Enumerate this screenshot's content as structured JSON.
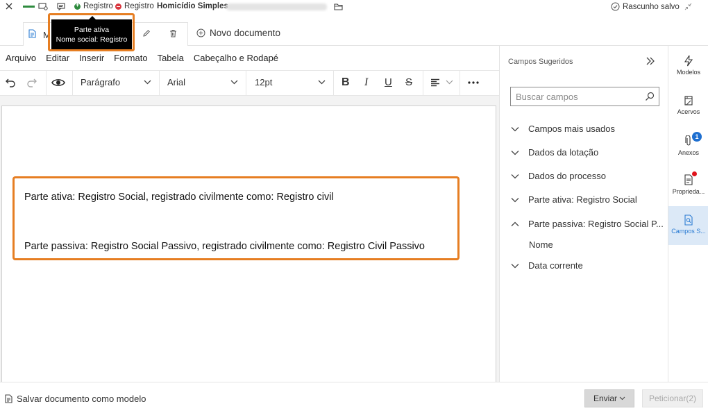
{
  "topbar": {
    "party1_label": "Registro",
    "party2_label": "Registro",
    "case_title": "Homicídio Simples",
    "draft_status": "Rascunho salvo"
  },
  "tooltip": {
    "line1": "Parte ativa",
    "line2": "Nome social: Registro"
  },
  "tabs": {
    "doc_tab_label": "M",
    "new_document_label": "Novo documento"
  },
  "menu": {
    "items": [
      "Arquivo",
      "Editar",
      "Inserir",
      "Formato",
      "Tabela",
      "Cabeçalho e Rodapé"
    ]
  },
  "toolbar": {
    "block_format": "Parágrafo",
    "font_family": "Arial",
    "font_size": "12pt"
  },
  "document": {
    "line1": "Parte ativa: Registro Social, registrado civilmente como: Registro civil",
    "line2": "Parte passiva: Registro Social Passivo, registrado civilmente como: Registro Civil Passivo"
  },
  "right_panel": {
    "title": "Campos Sugeridos",
    "search_placeholder": "Buscar campos",
    "fields": [
      {
        "label": "Campos mais usados",
        "expanded": false
      },
      {
        "label": "Dados da lotação",
        "expanded": false
      },
      {
        "label": "Dados do processo",
        "expanded": false
      },
      {
        "label": "Parte ativa: Registro Social",
        "expanded": false
      },
      {
        "label": "Parte passiva: Registro Social P...",
        "expanded": true
      },
      {
        "label": "Data corrente",
        "expanded": false
      }
    ],
    "subfield": "Nome"
  },
  "rail": {
    "items": [
      "Modelos",
      "Acervos",
      "Anexos",
      "Proprieda...",
      "Campos S..."
    ],
    "anexos_badge": "1",
    "active_color": "#dce9f7"
  },
  "bottom": {
    "save_as_model": "Salvar documento como modelo",
    "send": "Enviar",
    "petition": "Peticionar(2)"
  },
  "colors": {
    "highlight_orange": "#e67e22",
    "accent_blue": "#2b7cd3"
  }
}
